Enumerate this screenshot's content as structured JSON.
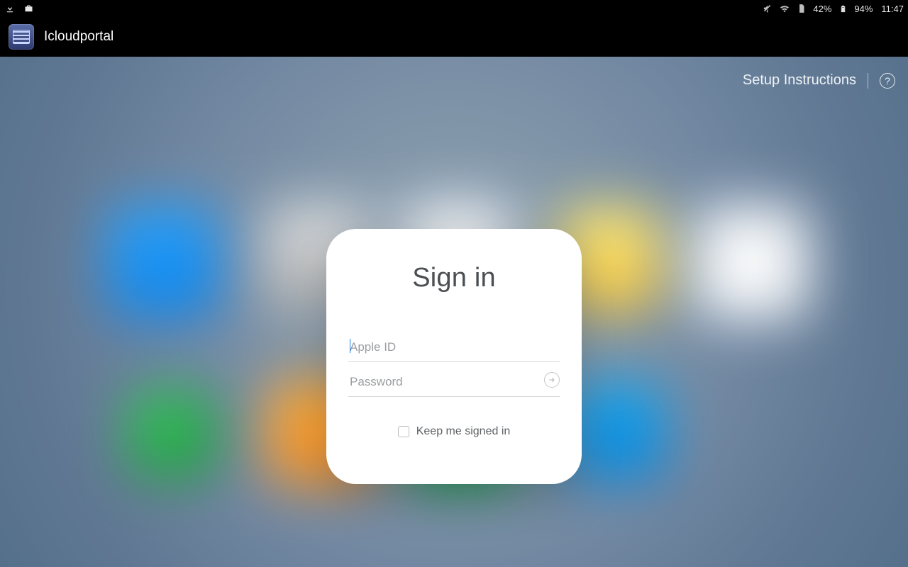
{
  "status": {
    "battery1_pct": "42%",
    "battery2_pct": "94%",
    "time": "11:47"
  },
  "app": {
    "title": "Icloudportal"
  },
  "links": {
    "setup": "Setup Instructions",
    "help_glyph": "?"
  },
  "signin": {
    "heading": "Sign in",
    "apple_id_placeholder": "Apple ID",
    "password_placeholder": "Password",
    "keep_label": "Keep me signed in"
  }
}
